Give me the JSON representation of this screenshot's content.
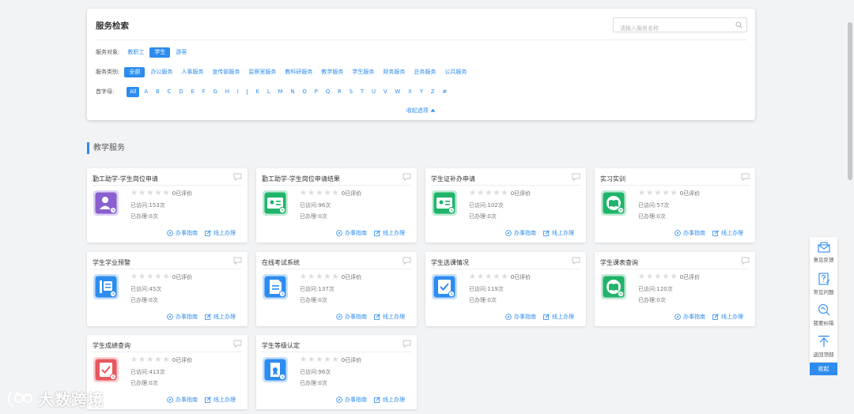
{
  "search_panel": {
    "title": "服务检索",
    "search_placeholder": "请输入服务名称",
    "audience": {
      "label": "服务对象:",
      "options": [
        "教职工",
        "学生",
        "游客"
      ],
      "selected": "学生"
    },
    "category": {
      "label": "服务类别:",
      "options": [
        "全部",
        "办公服务",
        "人事服务",
        "宣传部服务",
        "监察室服务",
        "教科研服务",
        "教学服务",
        "学生服务",
        "财务服务",
        "总务服务",
        "公共服务"
      ],
      "selected": "全部"
    },
    "initial": {
      "label": "首字母:",
      "options": [
        "All",
        "A",
        "B",
        "C",
        "D",
        "E",
        "F",
        "G",
        "H",
        "I",
        "J",
        "K",
        "L",
        "M",
        "N",
        "O",
        "P",
        "Q",
        "R",
        "S",
        "T",
        "U",
        "V",
        "W",
        "X",
        "Y",
        "Z",
        "#"
      ],
      "selected": "All"
    },
    "collapse_label": "收起选项"
  },
  "section": {
    "title": "教学服务"
  },
  "card_labels": {
    "eval": "0已评价",
    "visits_prefix": "已访问:",
    "done_prefix": "已办理:",
    "guide": "办事指南",
    "online": "线上办理"
  },
  "cards": [
    {
      "title": "勤工助学-学生岗位申请",
      "visits": "153次",
      "done": "0次",
      "icon": "person-card-icon",
      "color": "#8a5fd0"
    },
    {
      "title": "勤工助学-学生岗位申请结果",
      "visits": "96次",
      "done": "0次",
      "icon": "id-card-icon",
      "color": "#1fb46a"
    },
    {
      "title": "学生证补办申请",
      "visits": "102次",
      "done": "0次",
      "icon": "id-card-icon",
      "color": "#1fb46a"
    },
    {
      "title": "实习实训",
      "visits": "57次",
      "done": "0次",
      "icon": "book-icon",
      "color": "#1fb46a"
    },
    {
      "title": "学生学业预警",
      "visits": "45次",
      "done": "0次",
      "icon": "alert-board-icon",
      "color": "#2d8cf0"
    },
    {
      "title": "在线考试系统",
      "visits": "137次",
      "done": "0次",
      "icon": "document-icon",
      "color": "#2d8cf0"
    },
    {
      "title": "学生选课情况",
      "visits": "119次",
      "done": "0次",
      "icon": "checklist-icon",
      "color": "#2d8cf0"
    },
    {
      "title": "学生课表查询",
      "visits": "120次",
      "done": "0次",
      "icon": "book-icon",
      "color": "#1fb46a"
    },
    {
      "title": "学生成绩查询",
      "visits": "413次",
      "done": "0次",
      "icon": "checklist-icon",
      "color": "#e8565e"
    },
    {
      "title": "学生等级认定",
      "visits": "96次",
      "done": "0次",
      "icon": "certificate-icon",
      "color": "#2d8cf0"
    }
  ],
  "float_bar": {
    "items": [
      {
        "label": "意见反馈",
        "icon": "feedback-icon"
      },
      {
        "label": "常见问题",
        "icon": "faq-icon"
      },
      {
        "label": "我要纠错",
        "icon": "correction-icon"
      },
      {
        "label": "返回顶部",
        "icon": "back-to-top-icon"
      }
    ],
    "collapse_label": "收起"
  },
  "watermark": {
    "text": "大数跨境"
  }
}
